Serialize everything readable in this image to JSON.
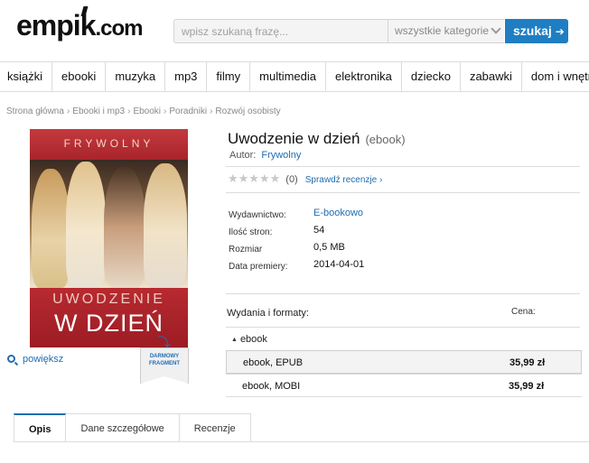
{
  "header": {
    "logo_text": "empik",
    "logo_suffix": ".com",
    "search_placeholder": "wpisz szukaną frazę...",
    "category_label": "wszystkie kategorie",
    "search_button": "szukaj",
    "search_button_arrow": "➔"
  },
  "nav": {
    "items": [
      "książki",
      "ebooki",
      "muzyka",
      "mp3",
      "filmy",
      "multimedia",
      "elektronika",
      "dziecko",
      "zabawki",
      "dom i wnętrze"
    ]
  },
  "breadcrumb": [
    "Strona główna",
    "Ebooki i mp3",
    "Ebooki",
    "Poradniki",
    "Rozwój osobisty"
  ],
  "cover": {
    "author": "FRYWOLNY",
    "title_line1": "UWODZENIE",
    "title_line2": "W DZIEŃ",
    "ribbon_line1": "DARMOWY",
    "ribbon_line2": "FRAGMENT",
    "zoom_label": "powiększ"
  },
  "product": {
    "title": "Uwodzenie w dzień",
    "format": "(ebook)",
    "author_label": "Autor:",
    "author_name": "Frywolny",
    "rating_stars": "★★★★★",
    "rating_count": "(0)",
    "reviews_link": "Sprawdź recenzje ›"
  },
  "details": [
    {
      "key": "Wydawnictwo:",
      "value": "E-bookowo",
      "is_link": true
    },
    {
      "key": "Ilość stron:",
      "value": "54",
      "is_link": false
    },
    {
      "key": "Rozmiar",
      "value": "0,5 MB",
      "is_link": false
    },
    {
      "key": "Data premiery:",
      "value": "2014-04-01",
      "is_link": false
    }
  ],
  "editions": {
    "header": "Wydania i formaty:",
    "price_header": "Cena:",
    "group_label": "ebook",
    "rows": [
      {
        "name": "ebook, EPUB",
        "price": "35,99 zł",
        "selected": true
      },
      {
        "name": "ebook, MOBI",
        "price": "35,99 zł",
        "selected": false
      }
    ]
  },
  "tabs": [
    {
      "label": "Opis",
      "active": true
    },
    {
      "label": "Dane szczegółowe",
      "active": false
    },
    {
      "label": "Recenzje",
      "active": false
    }
  ],
  "colors": {
    "accent": "#1f7ec2",
    "link": "#1f6db0",
    "cover_red": "#b2222c"
  }
}
